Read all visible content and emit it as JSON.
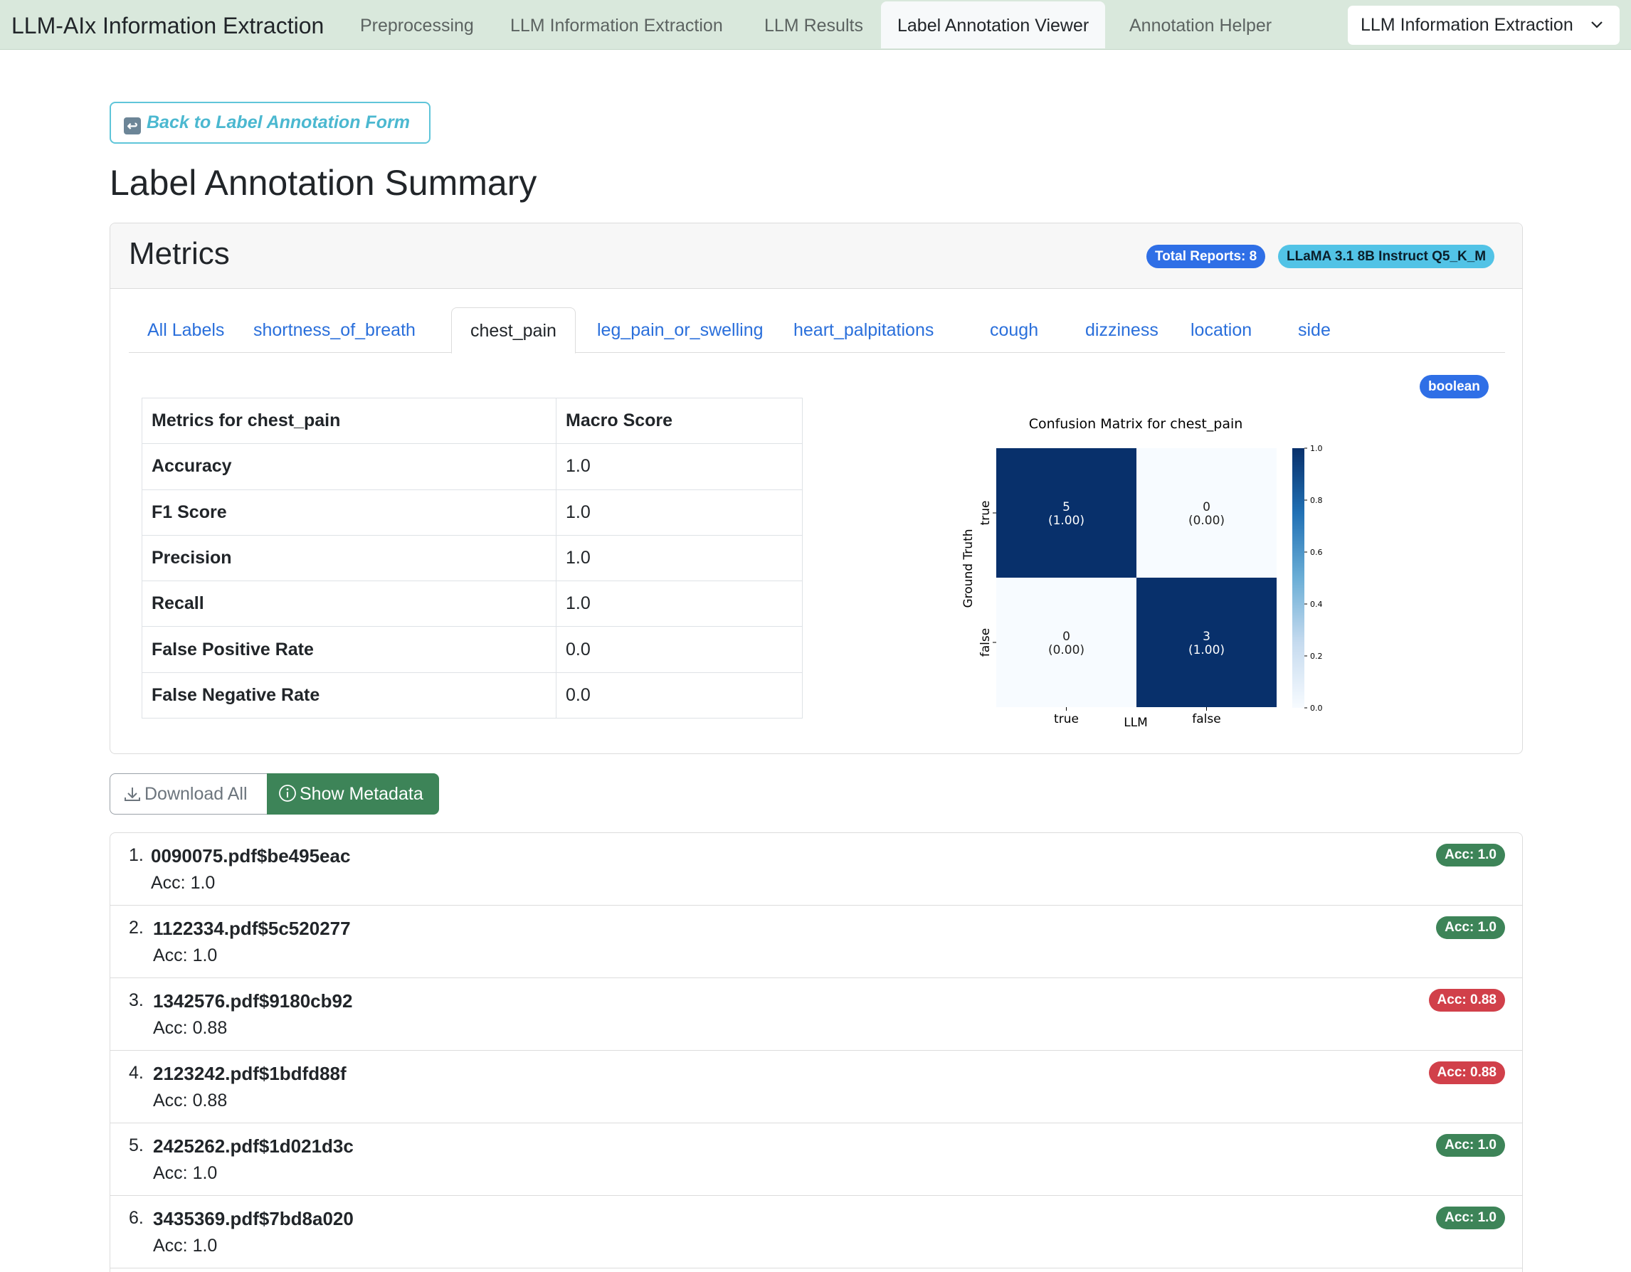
{
  "navbar": {
    "brand": "LLM-AIx Information Extraction",
    "items": [
      "Preprocessing",
      "LLM Information Extraction",
      "LLM Results",
      "Label Annotation Viewer",
      "Annotation Helper"
    ],
    "active_item": "Label Annotation Viewer",
    "mode_select": "LLM Information Extraction"
  },
  "back_button": "Back to Label Annotation Form",
  "page_title": "Label Annotation Summary",
  "metrics_card": {
    "title": "Metrics",
    "total_reports_badge": "Total Reports: 8",
    "model_badge": "LLaMA 3.1 8B Instruct Q5_K_M",
    "tabs": [
      "All Labels",
      "shortness_of_breath",
      "chest_pain",
      "leg_pain_or_swelling",
      "heart_palpitations",
      "cough",
      "dizziness",
      "location",
      "side"
    ],
    "active_tab": "chest_pain",
    "type_badge": "boolean",
    "table": {
      "header": [
        "Metrics for chest_pain",
        "Macro Score"
      ],
      "rows": [
        {
          "name": "Accuracy",
          "value": "1.0"
        },
        {
          "name": "F1 Score",
          "value": "1.0"
        },
        {
          "name": "Precision",
          "value": "1.0"
        },
        {
          "name": "Recall",
          "value": "1.0"
        },
        {
          "name": "False Positive Rate",
          "value": "0.0"
        },
        {
          "name": "False Negative Rate",
          "value": "0.0"
        }
      ]
    }
  },
  "chart_data": {
    "type": "heatmap",
    "title": "Confusion Matrix for chest_pain",
    "xlabel": "LLM",
    "ylabel": "Ground Truth",
    "x_categories": [
      "true",
      "false"
    ],
    "y_categories": [
      "true",
      "false"
    ],
    "counts": [
      [
        5,
        0
      ],
      [
        0,
        3
      ]
    ],
    "normalized": [
      [
        1.0,
        0.0
      ],
      [
        0.0,
        1.0
      ]
    ],
    "cell_labels": [
      [
        "5",
        "(1.00)",
        "0",
        "(0.00)"
      ],
      [
        "0",
        "(0.00)",
        "3",
        "(1.00)"
      ]
    ],
    "colorbar_ticks": [
      "1.0",
      "0.8",
      "0.6",
      "0.4",
      "0.2",
      "0.0"
    ],
    "colorbar_range": [
      0,
      1
    ],
    "colormap": [
      "#f7fbff",
      "#08306b"
    ]
  },
  "buttons": {
    "download_all": "Download All",
    "show_metadata": "Show Metadata"
  },
  "reports": [
    {
      "index": "1.",
      "name": "0090075.pdf$be495eac",
      "acc_text": "Acc: 1.0",
      "badge": "Acc: 1.0",
      "status": "good"
    },
    {
      "index": "2.",
      "name": "1122334.pdf$5c520277",
      "acc_text": "Acc: 1.0",
      "badge": "Acc: 1.0",
      "status": "good"
    },
    {
      "index": "3.",
      "name": "1342576.pdf$9180cb92",
      "acc_text": "Acc: 0.88",
      "badge": "Acc: 0.88",
      "status": "bad"
    },
    {
      "index": "4.",
      "name": "2123242.pdf$1bdfd88f",
      "acc_text": "Acc: 0.88",
      "badge": "Acc: 0.88",
      "status": "bad"
    },
    {
      "index": "5.",
      "name": "2425262.pdf$1d021d3c",
      "acc_text": "Acc: 1.0",
      "badge": "Acc: 1.0",
      "status": "good"
    },
    {
      "index": "6.",
      "name": "3435369.pdf$7bd8a020",
      "acc_text": "Acc: 1.0",
      "badge": "Acc: 1.0",
      "status": "good"
    }
  ],
  "colors": {
    "navbar_bg": "#d9e8dc",
    "link_blue": "#2a6fdb",
    "success": "#3d8458",
    "danger": "#d1404a",
    "info": "#52c3e6",
    "primary": "#2f6fe6"
  }
}
